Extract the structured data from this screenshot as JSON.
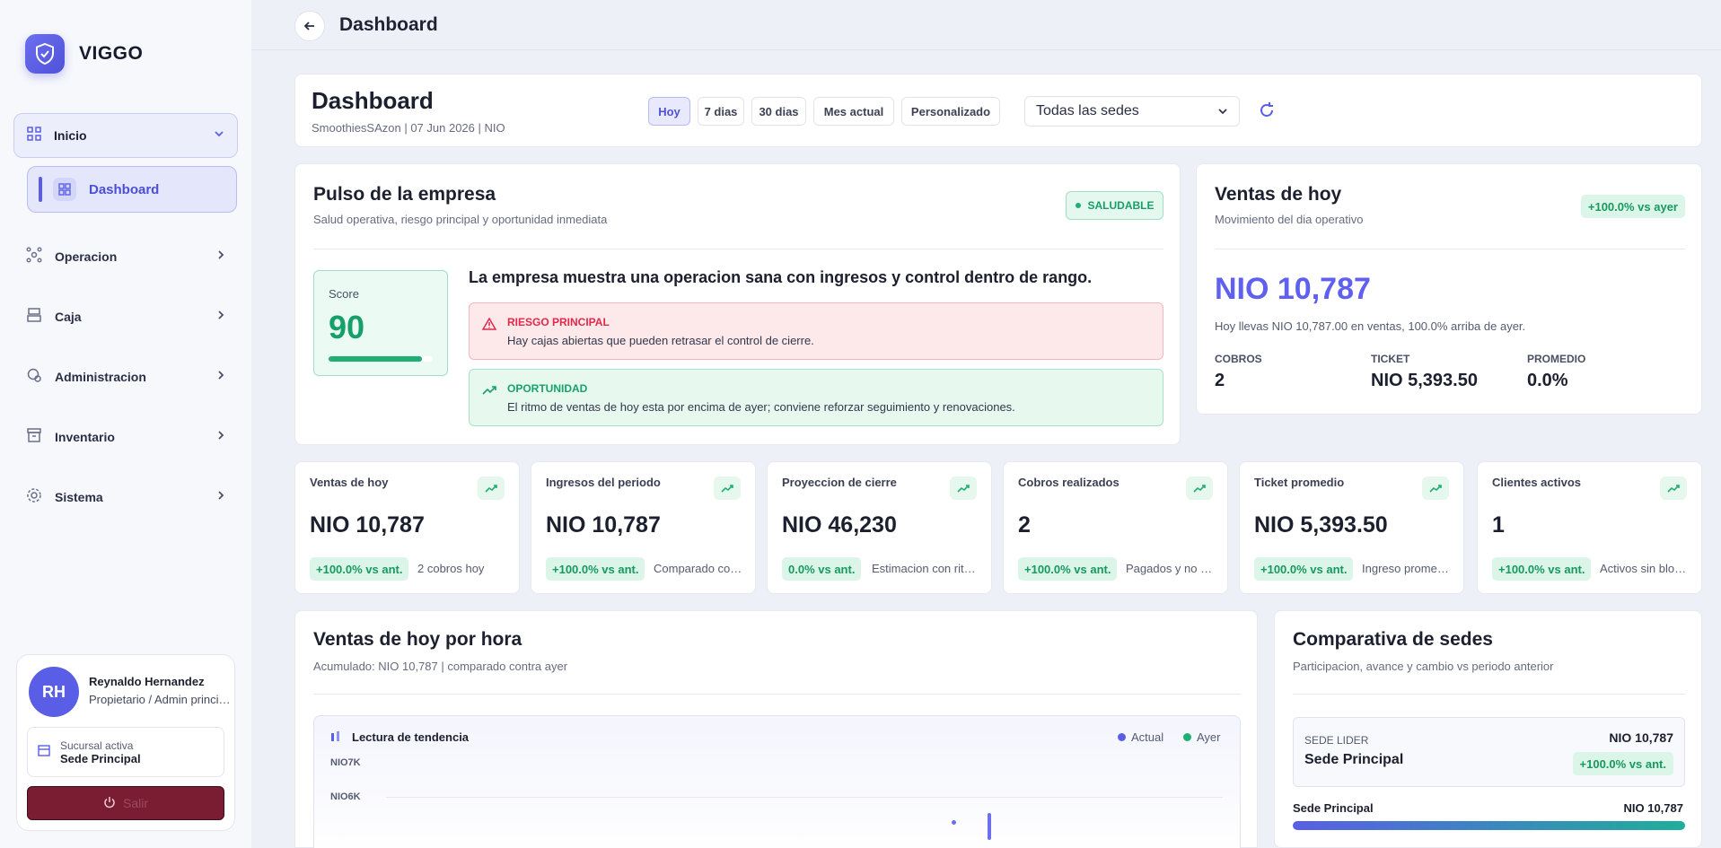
{
  "app": {
    "name": "VIGGO"
  },
  "sidebar": {
    "group": {
      "label": "Inicio"
    },
    "active_item": {
      "label": "Dashboard"
    },
    "items": [
      {
        "label": "Operacion",
        "icon": "nodes-icon"
      },
      {
        "label": "Caja",
        "icon": "register-icon"
      },
      {
        "label": "Administracion",
        "icon": "admin-icon"
      },
      {
        "label": "Inventario",
        "icon": "archive-icon"
      },
      {
        "label": "Sistema",
        "icon": "gear-icon"
      }
    ],
    "user": {
      "initials": "RH",
      "name": "Reynaldo Hernandez",
      "role": "Propietario / Admin principal",
      "branch_label": "Sucursal activa",
      "branch_name": "Sede Principal",
      "logout_label": "Salir"
    }
  },
  "header": {
    "title": "Dashboard"
  },
  "filters": {
    "title": "Dashboard",
    "subtitle": "SmoothiesSAzon | 07 Jun 2026 | NIO",
    "ranges": [
      "Hoy",
      "7 dias",
      "30 dias",
      "Mes actual",
      "Personalizado"
    ],
    "active_range": "Hoy",
    "sede_select": "Todas las sedes"
  },
  "pulse": {
    "title": "Pulso de la empresa",
    "subtitle": "Salud operativa, riesgo principal y oportunidad inmediata",
    "status": "SALUDABLE",
    "score_label": "Score",
    "score": "90",
    "score_fraction": 0.9,
    "message": "La empresa muestra una operacion sana con ingresos y control dentro de rango.",
    "risk_title": "RIESGO PRINCIPAL",
    "risk_text": "Hay cajas abiertas que pueden retrasar el control de cierre.",
    "opp_title": "OPORTUNIDAD",
    "opp_text": "El ritmo de ventas de hoy esta por encima de ayer; conviene reforzar seguimiento y renovaciones."
  },
  "sales_today": {
    "title": "Ventas de hoy",
    "subtitle": "Movimiento del dia operativo",
    "change": "+100.0% vs ayer",
    "amount": "NIO 10,787",
    "note": "Hoy llevas NIO 10,787.00 en ventas, 100.0% arriba de ayer.",
    "stats": [
      {
        "label": "COBROS",
        "value": "2"
      },
      {
        "label": "TICKET",
        "value": "NIO 5,393.50"
      },
      {
        "label": "PROMEDIO",
        "value": "0.0%"
      }
    ]
  },
  "kpis": [
    {
      "title": "Ventas de hoy",
      "value": "NIO 10,787",
      "pill": "+100.0% vs ant.",
      "note": "2 cobros hoy"
    },
    {
      "title": "Ingresos del periodo",
      "value": "NIO 10,787",
      "pill": "+100.0% vs ant.",
      "note": "Comparado contra periodo anterior"
    },
    {
      "title": "Proyeccion de cierre",
      "value": "NIO 46,230",
      "pill": "0.0% vs ant.",
      "note": "Estimacion con ritmo actual"
    },
    {
      "title": "Cobros realizados",
      "value": "2",
      "pill": "+100.0% vs ant.",
      "note": "Pagados y no anulados"
    },
    {
      "title": "Ticket promedio",
      "value": "NIO 5,393.50",
      "pill": "+100.0% vs ant.",
      "note": "Ingreso promedio por cobro"
    },
    {
      "title": "Clientes activos",
      "value": "1",
      "pill": "+100.0% vs ant.",
      "note": "Activos sin bloqueo"
    }
  ],
  "hourly": {
    "title": "Ventas de hoy por hora",
    "subtitle": "Acumulado: NIO 10,787 | comparado contra ayer",
    "chart_title": "Lectura de tendencia",
    "legend": [
      {
        "name": "Actual",
        "color": "#5a5ee6"
      },
      {
        "name": "Ayer",
        "color": "#1fae74"
      }
    ],
    "y_ticks": [
      "NIO7K",
      "NIO6K"
    ]
  },
  "comparison": {
    "title": "Comparativa de sedes",
    "subtitle": "Participacion, avance y cambio vs periodo anterior",
    "lider_label": "SEDE LIDER",
    "lider_name": "Sede Principal",
    "lider_amount": "NIO 10,787",
    "lider_change": "+100.0% vs ant.",
    "row_name": "Sede Principal",
    "row_amount": "NIO 10,787"
  }
}
